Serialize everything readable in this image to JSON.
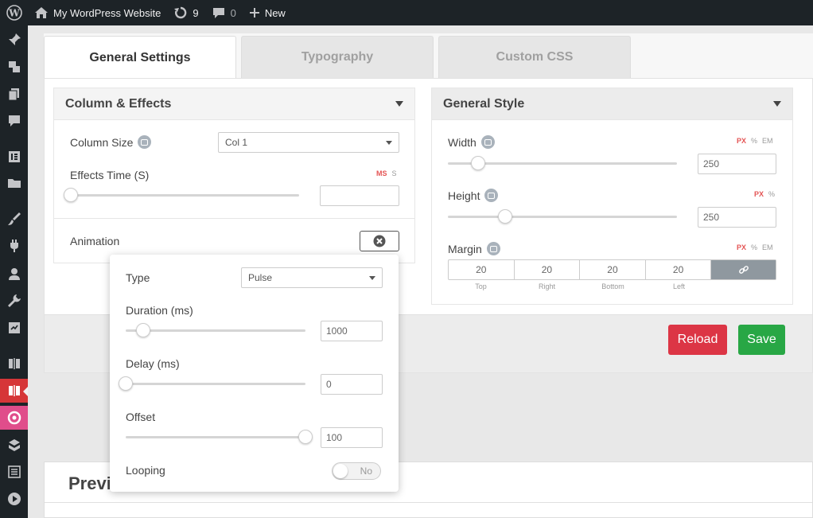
{
  "adminbar": {
    "site_name": "My WordPress Website",
    "updates_count": "9",
    "comments_count": "0",
    "new_label": "New"
  },
  "tabs": [
    {
      "label": "General Settings"
    },
    {
      "label": "Typography"
    },
    {
      "label": "Custom CSS"
    }
  ],
  "column_effects": {
    "title": "Column & Effects",
    "column_size_label": "Column Size",
    "column_size_value": "Col 1",
    "effects_time_label": "Effects Time (S)",
    "effects_time_value": "",
    "units": [
      "MS",
      "S"
    ],
    "animation_label": "Animation"
  },
  "general_style": {
    "title": "General Style",
    "width_label": "Width",
    "width_value": "250",
    "height_label": "Height",
    "height_value": "250",
    "margin_label": "Margin",
    "units3": [
      "PX",
      "%",
      "EM"
    ],
    "units2": [
      "PX",
      "%"
    ],
    "margin": [
      {
        "value": "20",
        "caption": "Top"
      },
      {
        "value": "20",
        "caption": "Right"
      },
      {
        "value": "20",
        "caption": "Bottom"
      },
      {
        "value": "20",
        "caption": "Left"
      }
    ]
  },
  "buttons": {
    "reload": "Reload",
    "save": "Save"
  },
  "animation_popover": {
    "type_label": "Type",
    "type_value": "Pulse",
    "duration_label": "Duration (ms)",
    "duration_value": "1000",
    "delay_label": "Delay (ms)",
    "delay_value": "0",
    "offset_label": "Offset",
    "offset_value": "100",
    "looping_label": "Looping",
    "looping_value": "No"
  },
  "preview": {
    "title": "Previ"
  },
  "colors": {
    "adminbar_bg": "#1d2327",
    "active_menu": "#d63638",
    "reload": "#dc3545",
    "save": "#28a745",
    "unit_active": "#e45454"
  }
}
